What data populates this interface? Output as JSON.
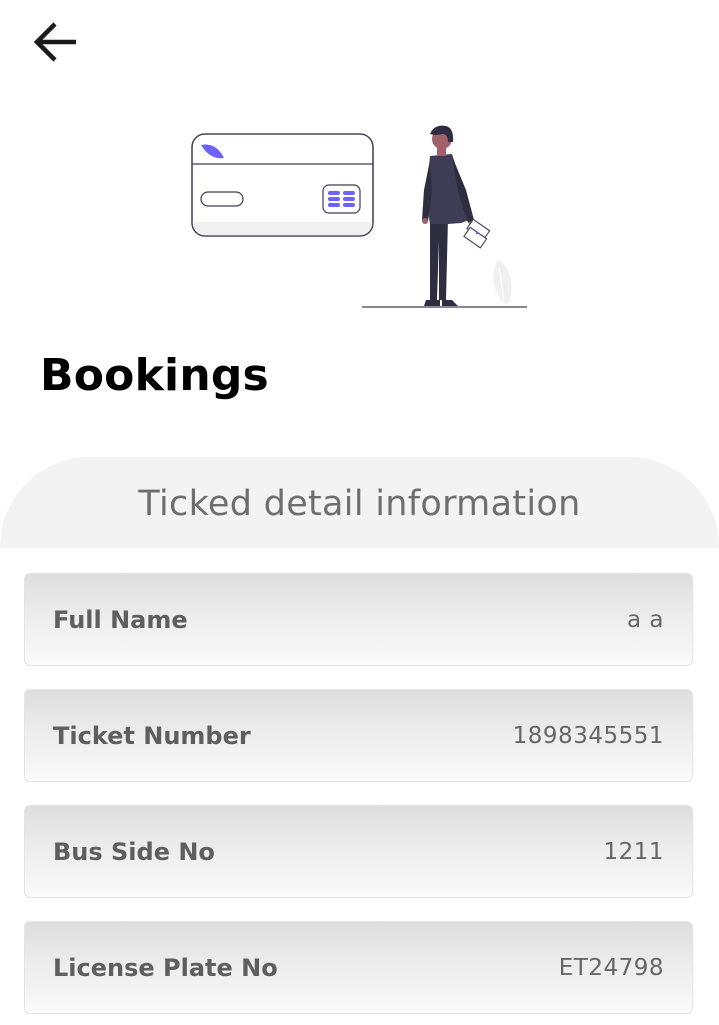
{
  "header": {
    "back_icon": "arrow-left-icon"
  },
  "illustration": {
    "name": "person-with-ticket-and-card-illustration",
    "colors": {
      "accent": "#6c63ff",
      "suit": "#2f2e41",
      "skin": "#a0616a"
    }
  },
  "page": {
    "title": "Bookings"
  },
  "section": {
    "title": "Ticked detail information"
  },
  "details": [
    {
      "label": "Full Name",
      "value": "a a"
    },
    {
      "label": "Ticket Number",
      "value": "1898345551"
    },
    {
      "label": "Bus Side No",
      "value": "1211"
    },
    {
      "label": "License Plate No",
      "value": "ET24798"
    }
  ]
}
